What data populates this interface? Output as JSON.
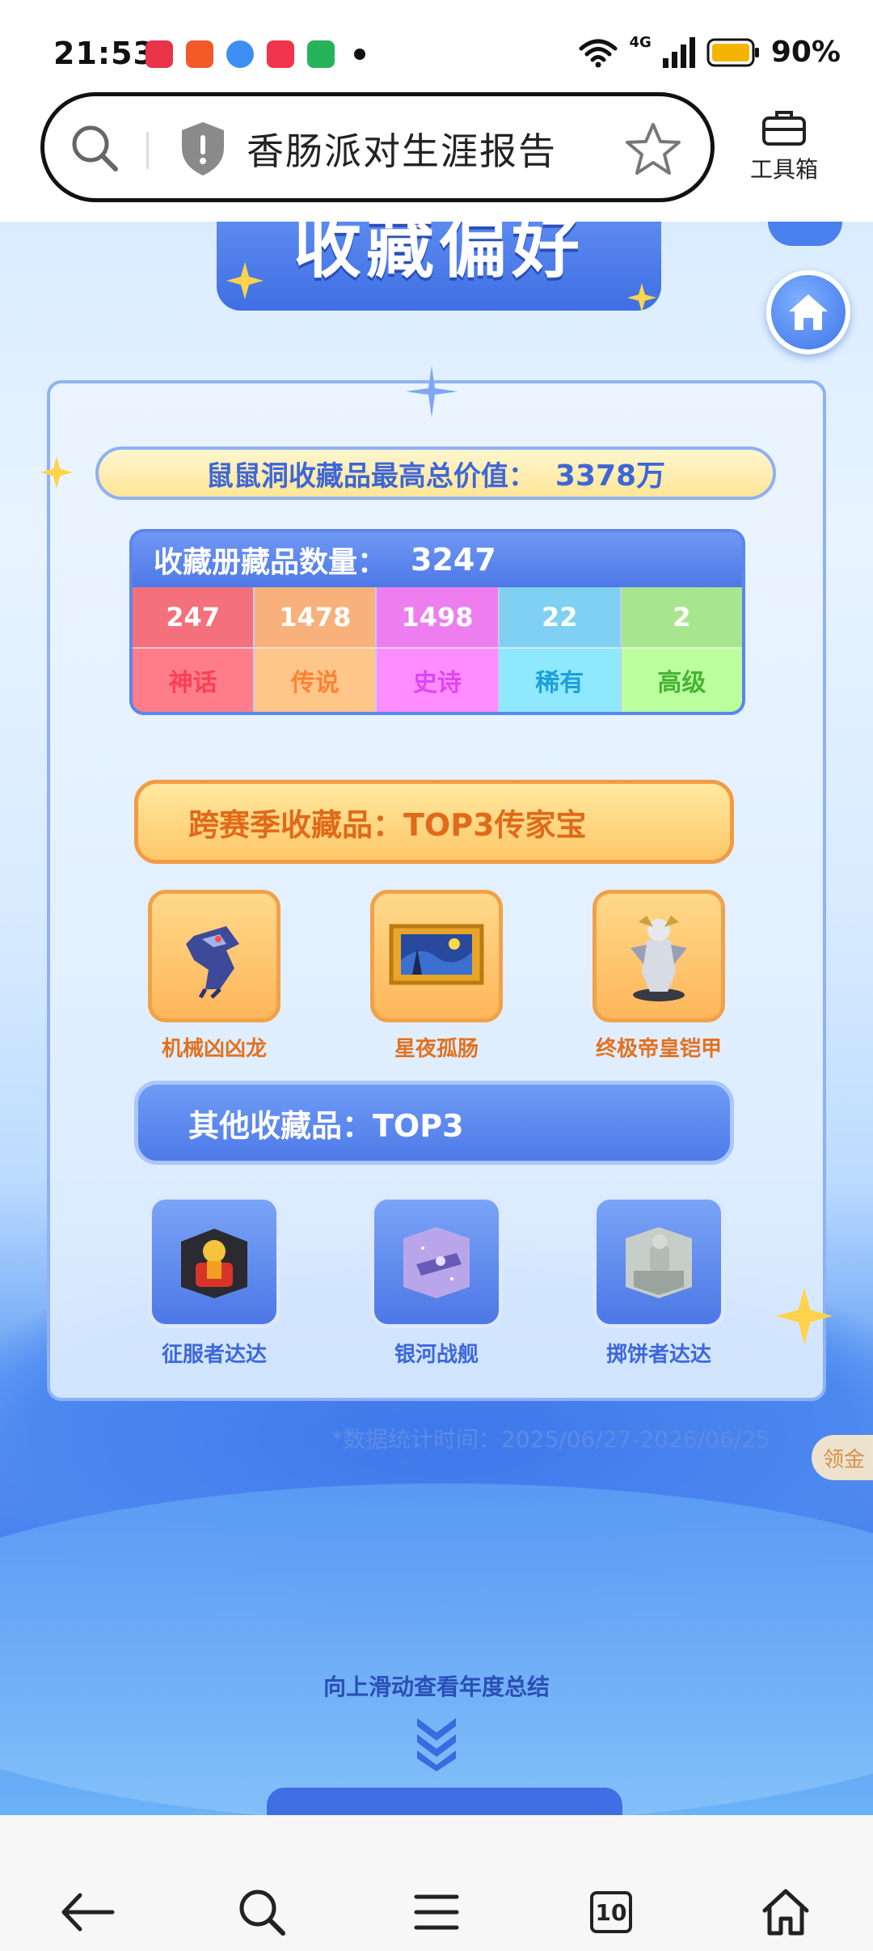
{
  "status_bar": {
    "time": "21:53",
    "network": "4G",
    "battery": "90%"
  },
  "address_bar": {
    "title": "香肠派对生涯报告",
    "toolbox_label": "工具箱"
  },
  "page": {
    "banner_title": "收藏偏好",
    "max_value_label": "鼠鼠洞收藏品最高总价值：",
    "max_value": "3378万",
    "collection_count_label": "收藏册藏品数量：",
    "collection_count": "3247",
    "rarities": [
      {
        "value": "247",
        "label": "神话",
        "color": "#f4707c",
        "text_color": "#e0394c"
      },
      {
        "value": "1478",
        "label": "传说",
        "color": "#f8b17a",
        "text_color": "#e8742e"
      },
      {
        "value": "1498",
        "label": "史诗",
        "color": "#ee7ef0",
        "text_color": "#c43fd6"
      },
      {
        "value": "22",
        "label": "稀有",
        "color": "#7fd0f2",
        "text_color": "#1b8fc2"
      },
      {
        "value": "2",
        "label": "高级",
        "color": "#a8e68e",
        "text_color": "#3ea02e"
      }
    ],
    "section_top3_legend": "跨赛季收藏品：TOP3传家宝",
    "legend_items": [
      {
        "name": "机械凶凶龙",
        "icon": "mecha-dragon-icon"
      },
      {
        "name": "星夜孤肠",
        "icon": "starry-night-painting-icon"
      },
      {
        "name": "终极帝皇铠甲",
        "icon": "emperor-armor-icon"
      }
    ],
    "section_top3_other": "其他收藏品：TOP3",
    "other_items": [
      {
        "name": "征服者达达",
        "icon": "conqueror-throne-icon"
      },
      {
        "name": "银河战舰",
        "icon": "galaxy-battleship-icon"
      },
      {
        "name": "掷饼者达达",
        "icon": "discus-statue-icon"
      }
    ],
    "stat_time": "*数据统计时间：2025/06/27-2026/06/25",
    "side_tab": "领金",
    "scroll_hint": "向上滑动查看年度总结"
  },
  "navbar": {
    "tabs_count": "10"
  },
  "colors": {
    "accent_blue": "#4a7fee",
    "gold": "#ffc768",
    "orange_text": "#e06a1a"
  }
}
